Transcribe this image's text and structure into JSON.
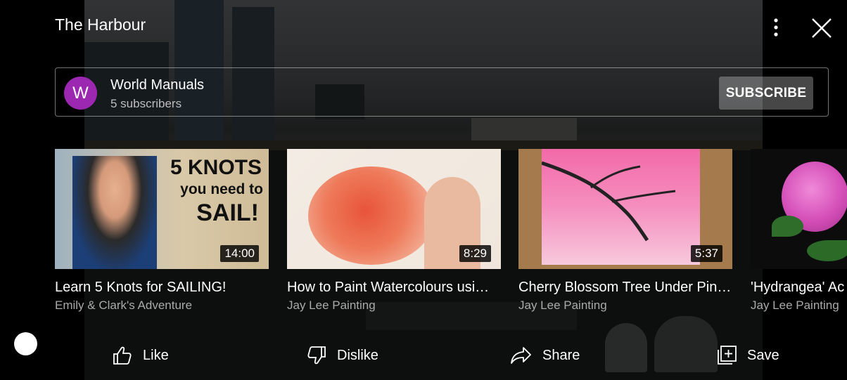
{
  "header": {
    "title": "The Harbour"
  },
  "channel": {
    "avatar_letter": "W",
    "name": "World Manuals",
    "subscribers": "5 subscribers",
    "subscribe_label": "SUBSCRIBE",
    "avatar_color": "#9c27b0"
  },
  "videos": [
    {
      "title": "Learn 5 Knots for SAILING!",
      "channel": "Emily & Clark's Adventure",
      "duration": "14:00",
      "thumb_text": [
        "5 KNOTS",
        "you need to",
        "SAIL!"
      ]
    },
    {
      "title": "How to Paint Watercolours usi…",
      "channel": "Jay Lee Painting",
      "duration": "8:29"
    },
    {
      "title": "Cherry Blossom Tree Under Pin…",
      "channel": "Jay Lee Painting",
      "duration": "5:37"
    },
    {
      "title": "'Hydrangea' Ac",
      "channel": "Jay Lee Painting",
      "duration": ""
    }
  ],
  "actions": {
    "like": "Like",
    "dislike": "Dislike",
    "share": "Share",
    "save": "Save"
  },
  "icons": {
    "more": "more-vert-icon",
    "close": "close-icon",
    "like": "thumb-up-icon",
    "dislike": "thumb-down-icon",
    "share": "share-icon",
    "save": "add-to-playlist-icon"
  }
}
